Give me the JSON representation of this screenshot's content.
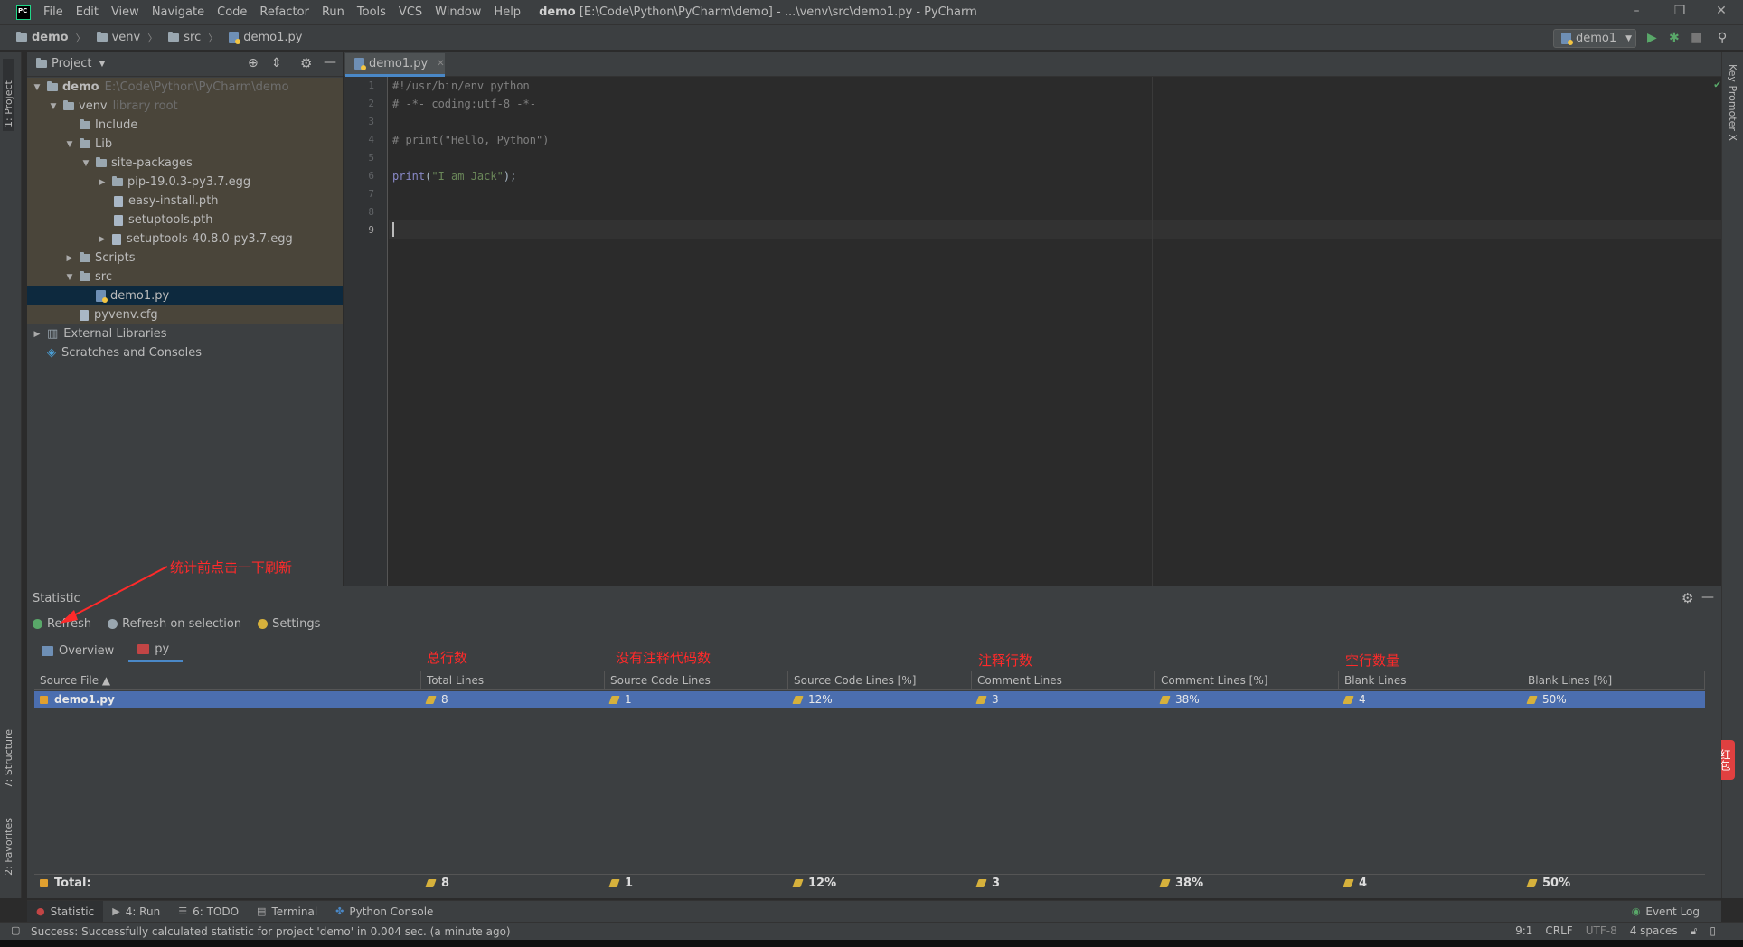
{
  "menu": [
    "File",
    "Edit",
    "View",
    "Navigate",
    "Code",
    "Refactor",
    "Run",
    "Tools",
    "VCS",
    "Window",
    "Help"
  ],
  "window_title_bold": "demo",
  "window_title_rest": "[E:\\Code\\Python\\PyCharm\\demo] - ...\\venv\\src\\demo1.py - PyCharm",
  "breadcrumbs": [
    "demo",
    "venv",
    "src",
    "demo1.py"
  ],
  "run_config": "demo1",
  "left_stripe": {
    "project": "1: Project",
    "structure": "7: Structure",
    "favorites": "2: Favorites"
  },
  "right_stripe": {
    "key_promoter": "Key Promoter X"
  },
  "project_panel": {
    "title": "Project",
    "tree": [
      {
        "label": "demo",
        "extra": "E:\\Code\\Python\\PyCharm\\demo"
      },
      {
        "label": "venv",
        "extra": "library root"
      },
      {
        "label": "Include",
        "extra": ""
      },
      {
        "label": "Lib",
        "extra": ""
      },
      {
        "label": "site-packages",
        "extra": ""
      },
      {
        "label": "pip-19.0.3-py3.7.egg",
        "extra": ""
      },
      {
        "label": "easy-install.pth",
        "extra": ""
      },
      {
        "label": "setuptools.pth",
        "extra": ""
      },
      {
        "label": "setuptools-40.8.0-py3.7.egg",
        "extra": ""
      },
      {
        "label": "Scripts",
        "extra": ""
      },
      {
        "label": "src",
        "extra": ""
      },
      {
        "label": "demo1.py",
        "extra": ""
      },
      {
        "label": "pyvenv.cfg",
        "extra": ""
      },
      {
        "label": "External Libraries",
        "extra": ""
      },
      {
        "label": "Scratches and Consoles",
        "extra": ""
      }
    ]
  },
  "editor": {
    "tab": "demo1.py",
    "line_numbers": [
      "1",
      "2",
      "3",
      "4",
      "5",
      "6",
      "7",
      "8",
      "9"
    ],
    "lines": {
      "l1": "#!/usr/bin/env python",
      "l2": "# -*- coding:utf-8 -*-",
      "l4": "# print(\"Hello, Python\")",
      "l6_kw": "print",
      "l6_open": "(",
      "l6_str": "\"I am Jack\"",
      "l6_close": ");"
    }
  },
  "statistic": {
    "title": "Statistic",
    "toolbar": {
      "refresh": "Refresh",
      "refresh_selection": "Refresh on selection",
      "settings": "Settings"
    },
    "subtabs": {
      "overview": "Overview",
      "py": "py"
    },
    "headers": {
      "source_file": "Source File ▲",
      "total_lines": "Total Lines",
      "source_code_lines": "Source Code Lines",
      "source_code_pct": "Source Code Lines [%]",
      "comment_lines": "Comment Lines",
      "comment_pct": "Comment Lines [%]",
      "blank_lines": "Blank Lines",
      "blank_pct": "Blank Lines [%]"
    },
    "row": {
      "file": "demo1.py",
      "total": "8",
      "source": "1",
      "source_pct": "12%",
      "comment": "3",
      "comment_pct": "38%",
      "blank": "4",
      "blank_pct": "50%"
    },
    "total": {
      "label": "Total:",
      "total": "8",
      "source": "1",
      "source_pct": "12%",
      "comment": "3",
      "comment_pct": "38%",
      "blank": "4",
      "blank_pct": "50%"
    }
  },
  "annotations": {
    "refresh_hint": "统计前点击一下刷新",
    "total_lines": "总行数",
    "source_lines": "没有注释代码数",
    "comment_lines": "注释行数",
    "blank_lines": "空行数量"
  },
  "side_badge": "红包",
  "bottom_tabs": [
    "Statistic",
    "4: Run",
    "6: TODO",
    "Terminal",
    "Python Console"
  ],
  "event_log": "Event Log",
  "status": {
    "message": "Success: Successfully calculated statistic for project 'demo' in 0.004 sec. (a minute ago)",
    "position": "9:1",
    "line_sep": "CRLF",
    "encoding": "UTF-8",
    "indent": "4 spaces"
  },
  "colors": {
    "accent": "#4a88c7",
    "selection": "#4b6eaf",
    "annotation": "#ff2a2a"
  }
}
